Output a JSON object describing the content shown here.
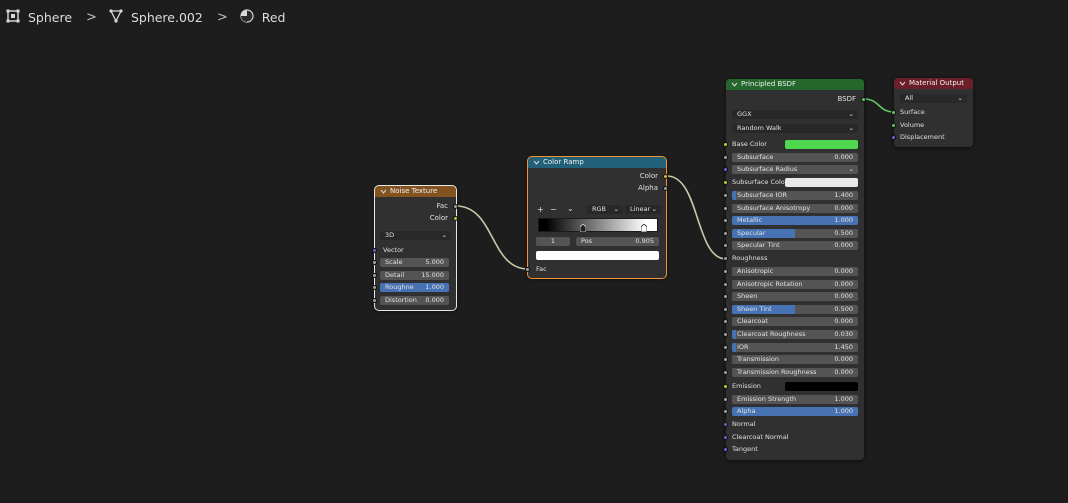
{
  "breadcrumb": {
    "object": "Sphere",
    "mesh": "Sphere.002",
    "material": "Red"
  },
  "colors": {
    "background": "#1d1d1d",
    "node_body": "#303030",
    "texture_header": "#83531f",
    "converter_header": "#236178",
    "shader_header": "#24662c",
    "output_header": "#6a1f2b",
    "slider_fill": "#4772b3",
    "base_color": "#4fd74e",
    "subsurface_color": "#e9e9e9",
    "emission": "#000000",
    "link": "#c7c7a0",
    "shader_link": "#63c763"
  },
  "noise_texture": {
    "title": "Noise Texture",
    "out_fac": "Fac",
    "out_color": "Color",
    "dimensions": "3D",
    "in_vector": "Vector",
    "fields": [
      {
        "label": "Scale",
        "value": "5.000",
        "fill": 0
      },
      {
        "label": "Detail",
        "value": "15.000",
        "fill": 0
      },
      {
        "label": "Roughne",
        "value": "1.000",
        "fill": 1
      },
      {
        "label": "Distortion",
        "value": "0.000",
        "fill": 0
      }
    ]
  },
  "color_ramp": {
    "title": "Color Ramp",
    "out_color": "Color",
    "out_alpha": "Alpha",
    "add": "+",
    "remove": "−",
    "menu": "⌄",
    "color_mode": "RGB",
    "interpolation": "Linear",
    "index": "1",
    "pos_label": "Pos",
    "pos_value": "0.905",
    "in_fac": "Fac"
  },
  "principled": {
    "title": "Principled BSDF",
    "out_bsdf": "BSDF",
    "distribution": "GGX",
    "subsurface_method": "Random Walk",
    "base_color_label": "Base Color",
    "subsurface": {
      "label": "Subsurface",
      "value": "0.000",
      "fill": 0
    },
    "subsurface_radius": "Subsurface Radius",
    "subsurface_color_label": "Subsurface Color",
    "fields_a": [
      {
        "label": "Subsurface IOR",
        "value": "1.400",
        "fill": 0.03
      },
      {
        "label": "Subsurface Anisotropy",
        "value": "0.000",
        "fill": 0
      },
      {
        "label": "Metallic",
        "value": "1.000",
        "fill": 1
      },
      {
        "label": "Specular",
        "value": "0.500",
        "fill": 0.5
      },
      {
        "label": "Specular Tint",
        "value": "0.000",
        "fill": 0
      }
    ],
    "roughness_label": "Roughness",
    "fields_b": [
      {
        "label": "Anisotropic",
        "value": "0.000",
        "fill": 0
      },
      {
        "label": "Anisotropic Rotation",
        "value": "0.000",
        "fill": 0
      },
      {
        "label": "Sheen",
        "value": "0.000",
        "fill": 0
      },
      {
        "label": "Sheen Tint",
        "value": "0.500",
        "fill": 0.5
      },
      {
        "label": "Clearcoat",
        "value": "0.000",
        "fill": 0
      },
      {
        "label": "Clearcoat Roughness",
        "value": "0.030",
        "fill": 0.03
      },
      {
        "label": "IOR",
        "value": "1.450",
        "fill": 0.03
      },
      {
        "label": "Transmission",
        "value": "0.000",
        "fill": 0
      },
      {
        "label": "Transmission Roughness",
        "value": "0.000",
        "fill": 0
      }
    ],
    "emission_label": "Emission",
    "fields_c": [
      {
        "label": "Emission Strength",
        "value": "1.000",
        "fill": 0
      },
      {
        "label": "Alpha",
        "value": "1.000",
        "fill": 1
      }
    ],
    "normal": "Normal",
    "clearcoat_normal": "Clearcoat Normal",
    "tangent": "Tangent"
  },
  "material_output": {
    "title": "Material Output",
    "target": "All",
    "surface": "Surface",
    "volume": "Volume",
    "displacement": "Displacement"
  }
}
